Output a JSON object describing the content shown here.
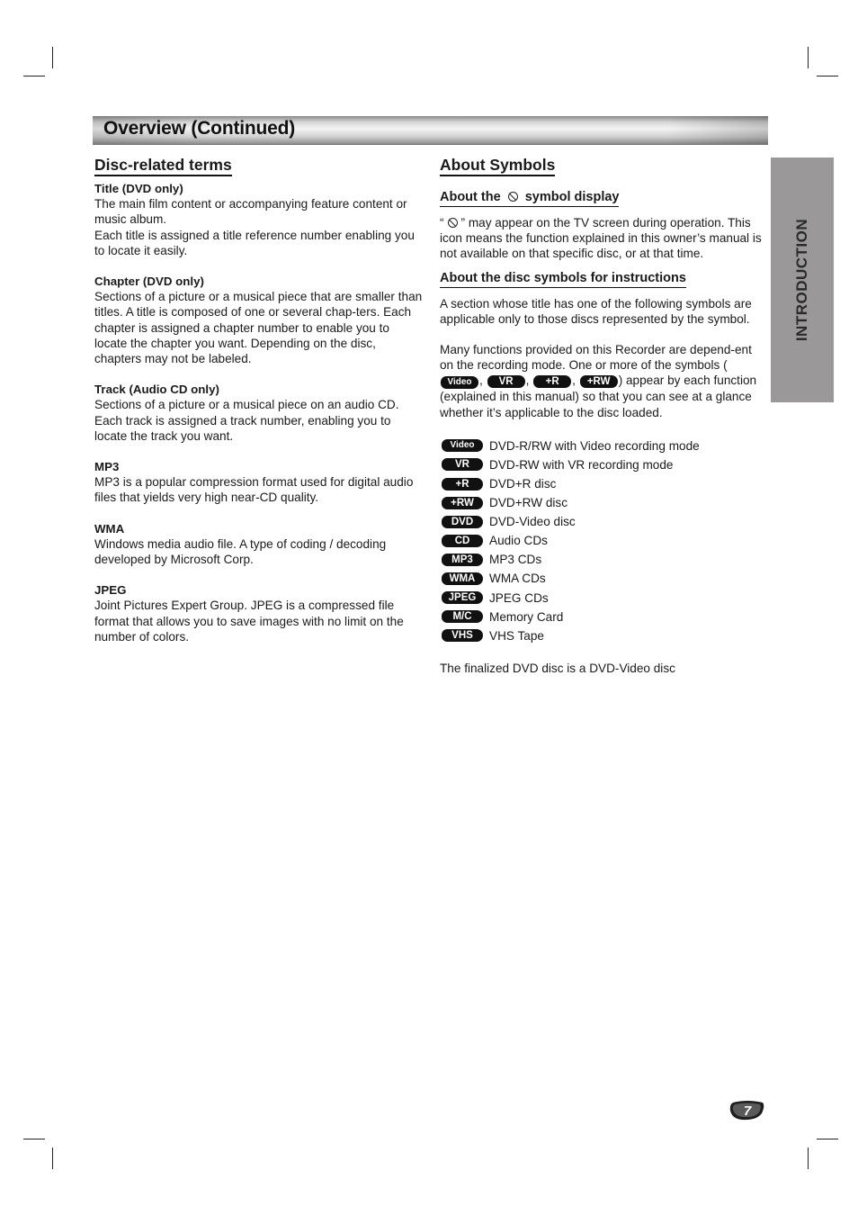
{
  "header": {
    "title": "Overview (Continued)"
  },
  "side_tab": {
    "label": "INTRODUCTION",
    "color": "#9a9898"
  },
  "left": {
    "heading": "Disc-related terms",
    "terms": [
      {
        "title": "Title (DVD only)",
        "body": [
          "The main film content or accompanying feature content or music album.",
          "Each title is assigned a title reference number enabling you to locate it easily."
        ]
      },
      {
        "title": "Chapter (DVD only)",
        "body": [
          "Sections of a picture or a musical piece that are smaller than titles. A title is composed of one or several chap-ters. Each chapter is assigned a chapter number to enable you to locate the chapter you want. Depending on the disc, chapters may not be labeled."
        ]
      },
      {
        "title": "Track (Audio CD only)",
        "body": [
          "Sections of a picture or a musical piece on an audio CD. Each track is assigned a track number, enabling you to locate the track you want."
        ]
      },
      {
        "title": "MP3",
        "body": [
          "MP3 is a popular compression format used for digital audio files that yields very high near-CD quality."
        ]
      },
      {
        "title": "WMA",
        "body": [
          "Windows media audio file. A type of coding / decoding developed by Microsoft Corp."
        ]
      },
      {
        "title": "JPEG",
        "body": [
          "Joint Pictures Expert Group. JPEG is a compressed file format that allows you to save images with no limit on the number of colors."
        ]
      }
    ]
  },
  "right": {
    "heading": "About Symbols",
    "symbol_display": {
      "heading_before": "About the",
      "heading_after": "symbol display",
      "icon": "prohibited-icon",
      "quote_open": "“",
      "quote_close": "” may appear on the TV screen during operation. This icon means the function explained in this owner’s manual is not available on that specific disc, or at that time."
    },
    "disc_symbols": {
      "heading": "About the disc symbols for instructions",
      "para1": "A section whose title has one of the following symbols are applicable only to those discs represented by the symbol.",
      "para2_start": "Many functions provided on this Recorder are depend-ent on the recording mode. One or more of the symbols (",
      "inline_pills": [
        "Video",
        "VR",
        "+R",
        "+RW"
      ],
      "para2_end": ") appear by each function (explained in this manual) so that you can see at a glance whether it’s applicable to the disc loaded.",
      "symbols": [
        {
          "badge": "Video",
          "label": "DVD-R/RW with Video recording mode"
        },
        {
          "badge": "VR",
          "label": "DVD-RW with VR recording mode"
        },
        {
          "badge": "+R",
          "label": "DVD+R disc"
        },
        {
          "badge": "+RW",
          "label": "DVD+RW disc"
        },
        {
          "badge": "DVD",
          "label": "DVD-Video disc"
        },
        {
          "badge": "CD",
          "label": "Audio CDs"
        },
        {
          "badge": "MP3",
          "label": "MP3 CDs"
        },
        {
          "badge": "WMA",
          "label": "WMA CDs"
        },
        {
          "badge": "JPEG",
          "label": "JPEG CDs"
        },
        {
          "badge": "M/C",
          "label": "Memory Card"
        },
        {
          "badge": "VHS",
          "label": "VHS Tape"
        }
      ],
      "footnote": "The finalized DVD disc is a DVD-Video disc"
    }
  },
  "footer": {
    "page_number": "7"
  }
}
